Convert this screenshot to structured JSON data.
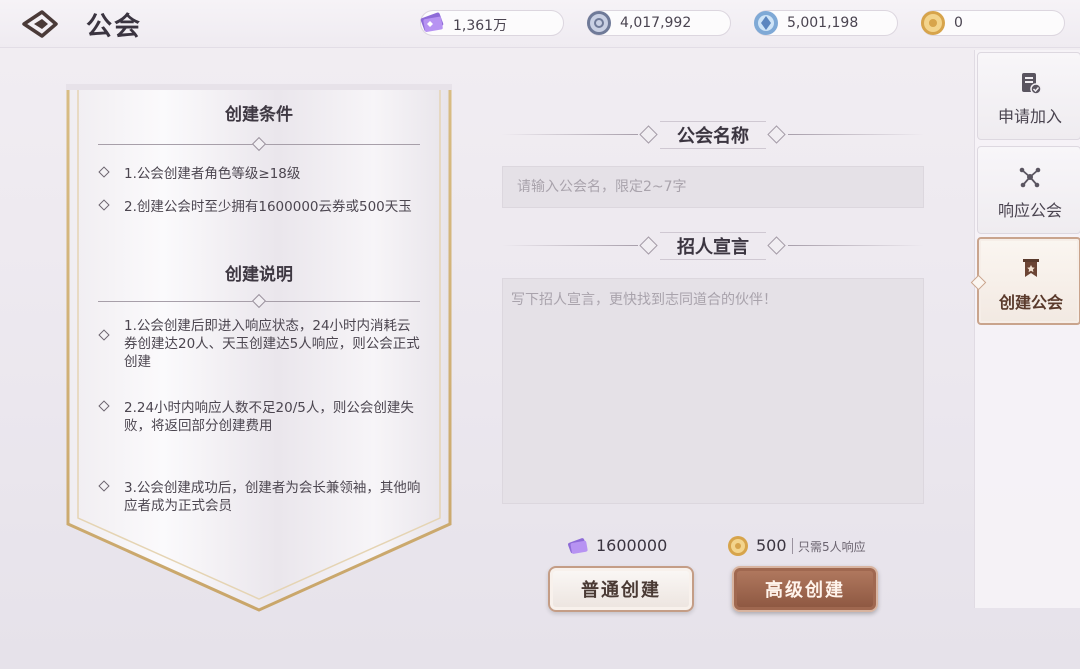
{
  "header": {
    "title": "公会",
    "currencies": [
      {
        "icon": "purple-ticket-icon",
        "value": "1,361万"
      },
      {
        "icon": "silver-coin-icon",
        "value": "4,017,992"
      },
      {
        "icon": "blue-crystal-icon",
        "value": "5,001,198"
      },
      {
        "icon": "gold-coin-icon",
        "value": "0"
      }
    ]
  },
  "requirements": {
    "title": "创建条件",
    "items": [
      "1.公会创建者角色等级≥18级",
      "2.创建公会时至少拥有1600000云券或500天玉"
    ]
  },
  "instructions": {
    "title": "创建说明",
    "items": [
      "1.公会创建后即进入响应状态，24小时内消耗云券创建达20人、天玉创建达5人响应，则公会正式创建",
      "2.24小时内响应人数不足20/5人，则公会创建失败，将返回部分创建费用",
      "3.公会创建成功后，创建者为会长兼领袖，其他响应者成为正式会员"
    ]
  },
  "form": {
    "name_label": "公会名称",
    "name_placeholder": "请输入公会名，限定2~7字",
    "name_value": "",
    "declaration_label": "招人宣言",
    "declaration_placeholder": "写下招人宣言，更快找到志同道合的伙伴！",
    "declaration_value": ""
  },
  "costs": {
    "normal": {
      "icon": "purple-ticket-icon",
      "value": "1600000"
    },
    "advanced": {
      "icon": "gold-coin-icon",
      "value": "500",
      "note": "只需5人响应"
    }
  },
  "buttons": {
    "normal_create": "普通创建",
    "advanced_create": "高级创建"
  },
  "tabs": [
    {
      "label": "申请加入",
      "icon": "document-check-icon",
      "active": false
    },
    {
      "label": "响应公会",
      "icon": "network-icon",
      "active": false
    },
    {
      "label": "创建公会",
      "icon": "guild-banner-icon",
      "active": true
    }
  ],
  "colors": {
    "accent_brown": "#8c5640",
    "gold_border": "#c49d86",
    "background": "#ece8ef"
  }
}
